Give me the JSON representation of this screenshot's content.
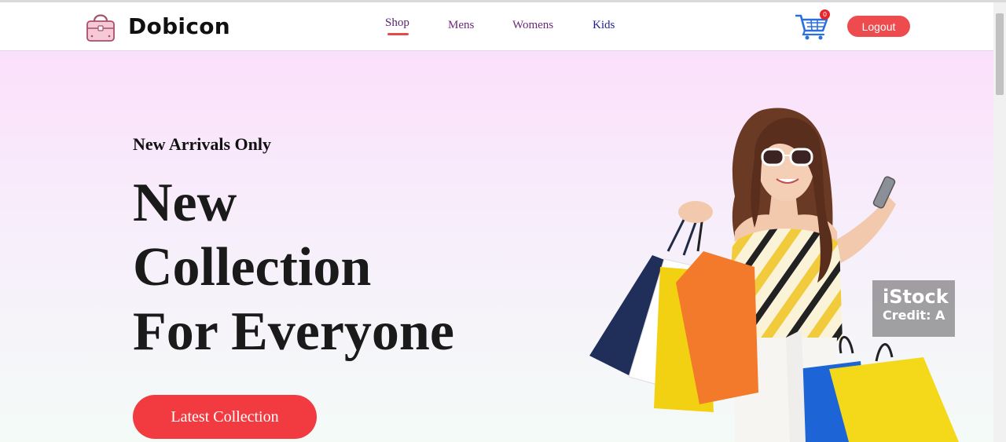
{
  "brand": {
    "name": "Dobicon",
    "logo_icon": "handbag-icon"
  },
  "nav": {
    "items": [
      {
        "label": "Shop",
        "active": true
      },
      {
        "label": "Mens"
      },
      {
        "label": "Womens"
      },
      {
        "label": "Kids"
      }
    ],
    "active_color": "#e8484a"
  },
  "cart": {
    "icon": "shopping-cart-icon",
    "count": "0"
  },
  "auth": {
    "logout_label": "Logout"
  },
  "hero": {
    "eyebrow": "New Arrivals Only",
    "headline_lines": [
      "New",
      "Collection",
      "For Everyone"
    ],
    "cta_label": "Latest Collection",
    "image": "woman-with-shopping-bags",
    "watermark": {
      "brand": "iStock",
      "credit": "Credit: A"
    }
  },
  "colors": {
    "accent": "#f23b40",
    "hero_top": "#fbe0fb",
    "hero_bottom": "#f4fbf7"
  }
}
